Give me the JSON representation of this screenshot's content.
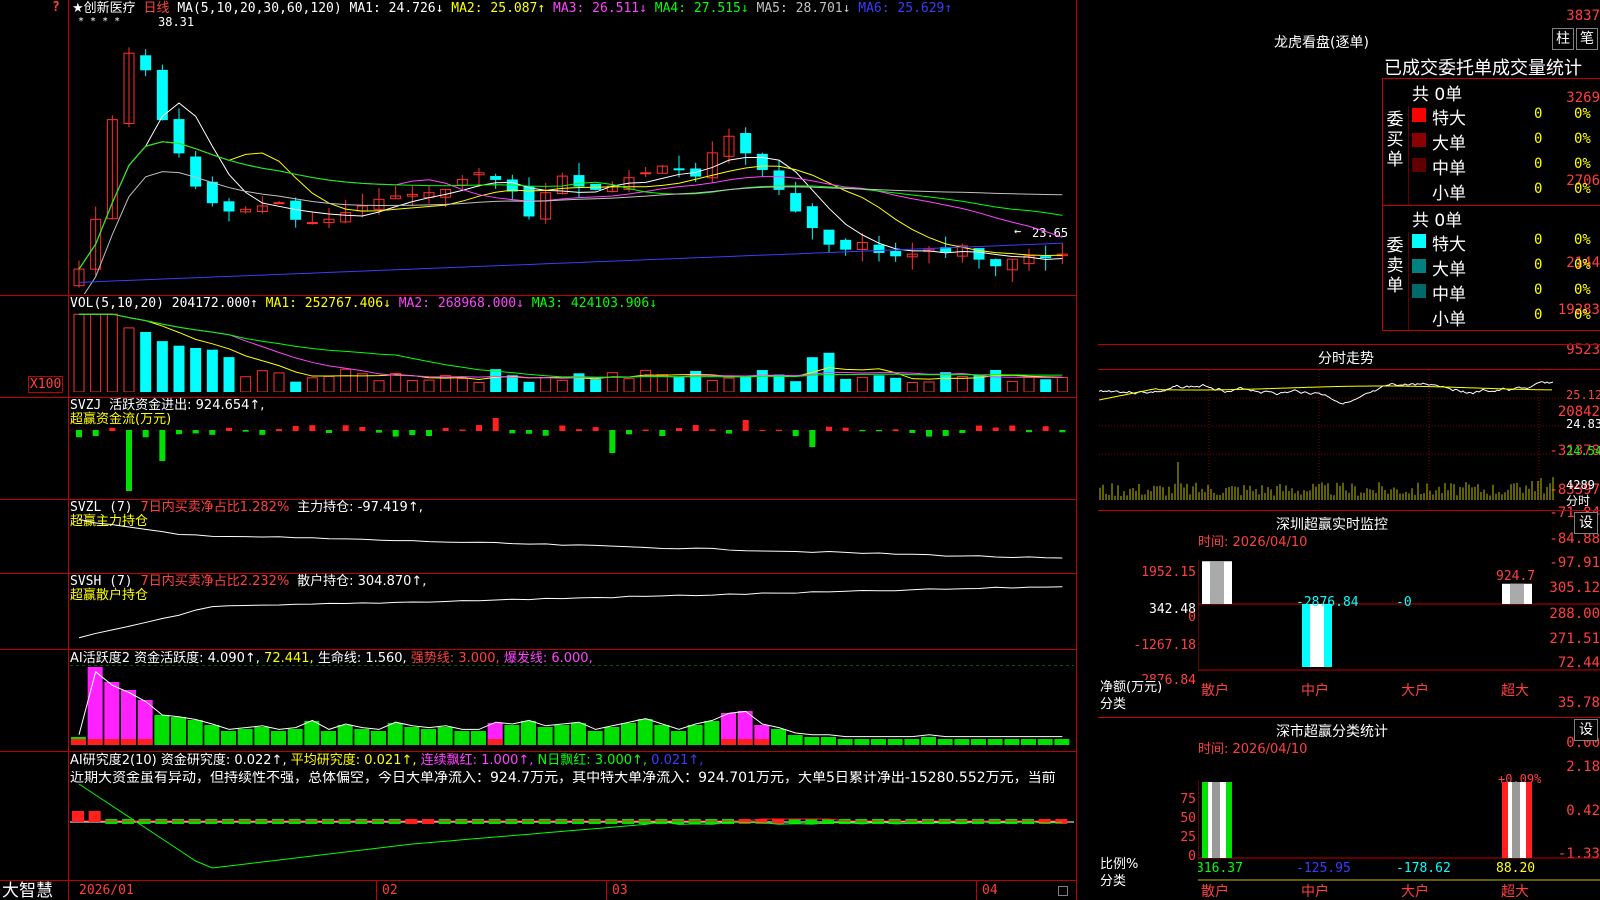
{
  "header": {
    "stock": "★创新医疗",
    "period": "日线",
    "ma_title": "MA(5,10,20,30,60,120)",
    "ma": [
      {
        "t": "MA1: 24.726↓",
        "c": "#ffffff"
      },
      {
        "t": "MA2: 25.087↑",
        "c": "#ffff00"
      },
      {
        "t": "MA3: 26.511↓",
        "c": "#ff44ff"
      },
      {
        "t": "MA4: 27.515↓",
        "c": "#00ff00"
      },
      {
        "t": "MA5: 28.701↓",
        "c": "#c0c0c0"
      },
      {
        "t": "MA6: 25.629↑",
        "c": "#3c3cff"
      }
    ]
  },
  "k_yaxis": [
    "3837",
    "3269",
    "2706",
    "2144"
  ],
  "k_hi_label": "38.31",
  "k_lo_label": "23.65",
  "vol": {
    "title": "VOL(5,10,20)",
    "v": "204172.000↑",
    "ma1": "MA1: 252767.406↓",
    "ma2": "MA2: 268968.000↓",
    "ma3": "MA3: 424103.906↓",
    "yaxis": [
      "19283",
      "9523"
    ],
    "unit": "X100"
  },
  "svzj": {
    "title": "SVZJ",
    "label": "活跃资金进出: 924.654↑,",
    "sub": "超赢资金流(万元)",
    "yaxis": [
      "20842",
      "-31378",
      "-83597"
    ]
  },
  "svzl": {
    "title": "SVZL (7)",
    "t1": "7日内买卖净占比1.282%",
    "t2": "主力持仓: -97.419↑,",
    "sub": "超赢主力持仓",
    "yaxis": [
      "-71.84",
      "-84.88",
      "-97.91"
    ]
  },
  "svsh": {
    "title": "SVSH (7)",
    "t1": "7日内买卖净占比2.232%",
    "t2": "散户持仓: 304.870↑,",
    "sub": "超赢散户持仓",
    "yaxis": [
      "305.12",
      "288.00",
      "271.51"
    ]
  },
  "ai1": {
    "title": "AI活跃度2",
    "t1": "资金活跃度: 4.090↑,",
    "t2": "72.441,",
    "t3": "生命线: 1.560,",
    "t4": "强势线: 3.000,",
    "t5": "爆发线: 6.000,",
    "yaxis": [
      "72.44",
      "35.78",
      "0.00"
    ]
  },
  "ai2": {
    "title": "AI研究度2(10)",
    "t1": "资金研究度: 0.022↑,",
    "t2": "平均研究度: 0.021↑,",
    "t3": "连续飘红: 1.000↑,",
    "t4": "N日飘红: 3.000↑,",
    "t5": "0.021↑,",
    "desc": "近期大资金虽有异动，但持续性不强，总体偏空，今日大单净流入：924.7万元，其中特大单净流入：924.701万元，大单5日累计净出-15280.552万元，当前",
    "yaxis": [
      "2.18",
      "0.42",
      "-1.33"
    ]
  },
  "bottom": {
    "logo": "大智慧",
    "dates": [
      "2026/01",
      "02",
      "03",
      "04"
    ]
  },
  "lhb": {
    "title": "龙虎看盘(逐单)",
    "btn1": "柱",
    "btn2": "笔",
    "subtitle": "已成交委托单成交量统计",
    "buy": {
      "side": "委买单",
      "total": "共 0单",
      "rows": [
        {
          "n": "特大",
          "v": "0",
          "p": "0%",
          "c": "#ff0000"
        },
        {
          "n": "大单",
          "v": "0",
          "p": "0%",
          "c": "#8b0000"
        },
        {
          "n": "中单",
          "v": "0",
          "p": "0%",
          "c": "#600000"
        },
        {
          "n": "小单",
          "v": "0",
          "p": "0%",
          "c": ""
        }
      ]
    },
    "sell": {
      "side": "委卖单",
      "total": "共 0单",
      "rows": [
        {
          "n": "特大",
          "v": "0",
          "p": "0%",
          "c": "#00ffff"
        },
        {
          "n": "大单",
          "v": "0",
          "p": "0%",
          "c": "#008080"
        },
        {
          "n": "中单",
          "v": "0",
          "p": "0%",
          "c": "#006a6a"
        },
        {
          "n": "小单",
          "v": "0",
          "p": "0%",
          "c": ""
        }
      ]
    }
  },
  "fenshi": {
    "title": "分时走势",
    "y": [
      "25.12",
      "24.83",
      "24.54"
    ],
    "vol": "4289",
    "vol_unit": "分时"
  },
  "sz_monitor": {
    "title": "深圳超赢实时监控",
    "btn": "设",
    "time": "时间: 2026/04/10",
    "yaxis": [
      "1952.15",
      "342.48",
      "0",
      "-1267.18",
      "-2876.84"
    ],
    "ylabel": "净额(万元)",
    "xlabel": "分类",
    "vals": [
      "1952.15",
      "-2876.84",
      "-0",
      "924.7"
    ],
    "cats": [
      "散户",
      "中户",
      "大户",
      "超大"
    ]
  },
  "sz_class": {
    "title": "深市超赢分类统计",
    "btn": "设",
    "time": "时间: 2026/04/10",
    "yaxis": [
      "75",
      "50",
      "25",
      "0"
    ],
    "ylabel": "比例%",
    "xlabel": "分类",
    "top": "+0.09%",
    "vals": [
      "316.37",
      "-125.95",
      "-178.62",
      "88.20"
    ],
    "cats": [
      "散户",
      "中户",
      "大户",
      "超大"
    ]
  }
}
